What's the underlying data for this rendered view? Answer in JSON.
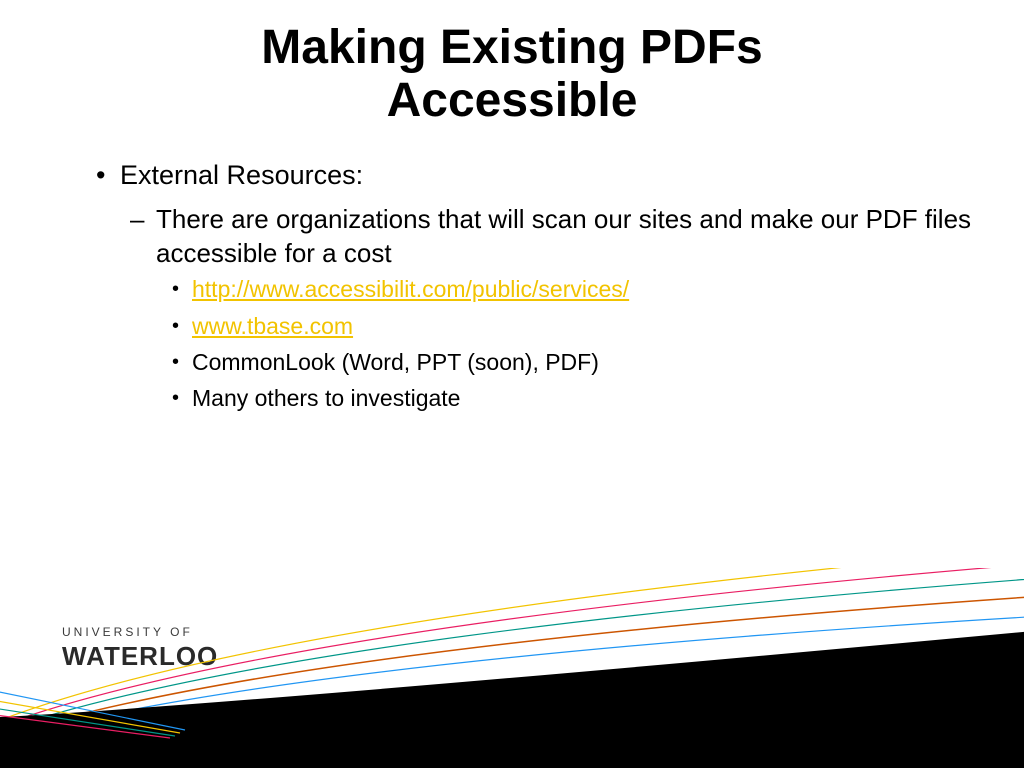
{
  "title_line1": "Making Existing PDFs",
  "title_line2": "Accessible",
  "bullet1": "External Resources:",
  "sub1": "There are organizations that will scan our sites and make our PDF files accessible for a cost",
  "link1": "http://www.accessibilit.com/public/services/",
  "link2": "www.tbase.com",
  "item3": "CommonLook (Word, PPT (soon), PDF)",
  "item4": "Many others to investigate",
  "logo_top": "UNIVERSITY OF",
  "logo_bottom": "WATERLOO"
}
